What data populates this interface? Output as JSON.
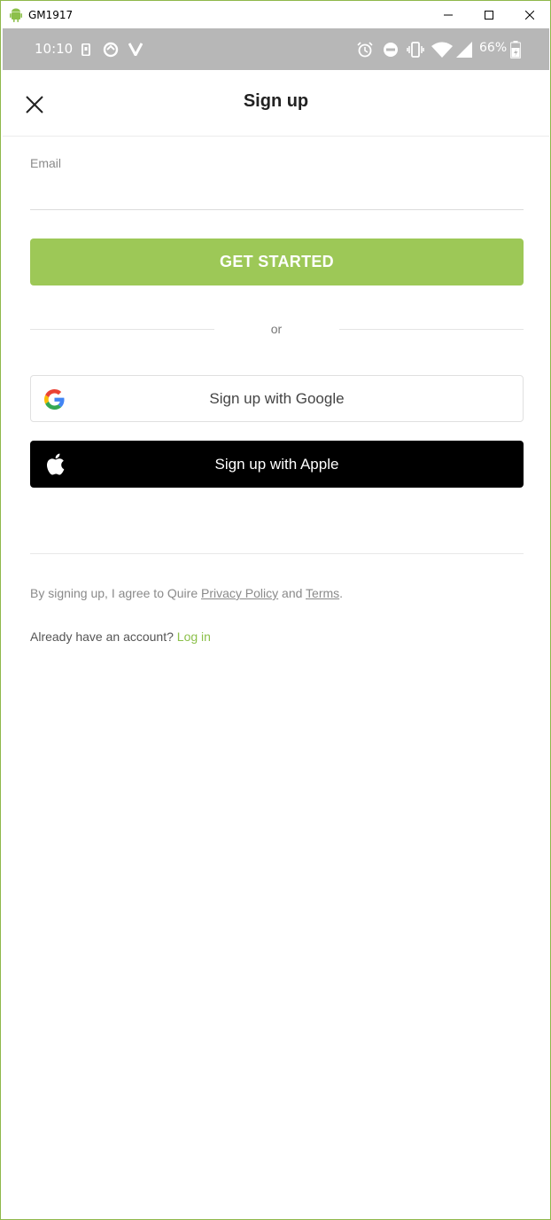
{
  "window": {
    "title": "GM1917"
  },
  "status_bar": {
    "time": "10:10",
    "battery": "66%"
  },
  "header": {
    "title": "Sign up"
  },
  "form": {
    "email_label": "Email",
    "email_value": "",
    "get_started_label": "GET STARTED",
    "or_label": "or",
    "google_label": "Sign up with Google",
    "apple_label": "Sign up with Apple"
  },
  "footer": {
    "terms_prefix": "By signing up, I agree to Quire ",
    "privacy_link": "Privacy Policy",
    "terms_and": " and ",
    "terms_link": "Terms",
    "terms_suffix": ".",
    "login_prefix": "Already have an account? ",
    "login_link": "Log in"
  },
  "colors": {
    "accent_green": "#9dc857",
    "link_green": "#8cc04b",
    "status_bar": "#b7b7b7"
  }
}
